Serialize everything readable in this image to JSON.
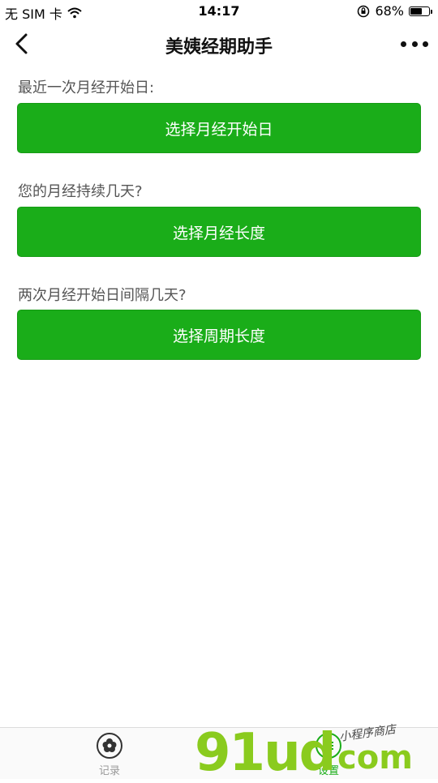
{
  "status_bar": {
    "carrier": "无 SIM 卡",
    "time": "14:17",
    "battery_percent": "68%",
    "battery_level": 0.68
  },
  "nav": {
    "title": "美姨经期助手",
    "back_icon": "chevron-left-icon",
    "more_icon": "more-dots-icon"
  },
  "form": {
    "sections": [
      {
        "label": "最近一次月经开始日:",
        "button": "选择月经开始日"
      },
      {
        "label": "您的月经持续几天?",
        "button": "选择月经长度"
      },
      {
        "label": "两次月经开始日间隔几天?",
        "button": "选择周期长度"
      }
    ]
  },
  "tab_bar": {
    "tabs": [
      {
        "label": "记录",
        "icon": "flower-icon",
        "active": false
      },
      {
        "label": "设置",
        "icon": "menu-lines-icon",
        "active": true
      }
    ]
  },
  "watermark": {
    "brand": "91ud",
    "domain": "com",
    "tagline": "小程序商店"
  },
  "colors": {
    "button_green": "#1aad19",
    "active_tab": "#1aad19",
    "inactive_tab": "#999999",
    "watermark_green": "#8acb1e"
  }
}
